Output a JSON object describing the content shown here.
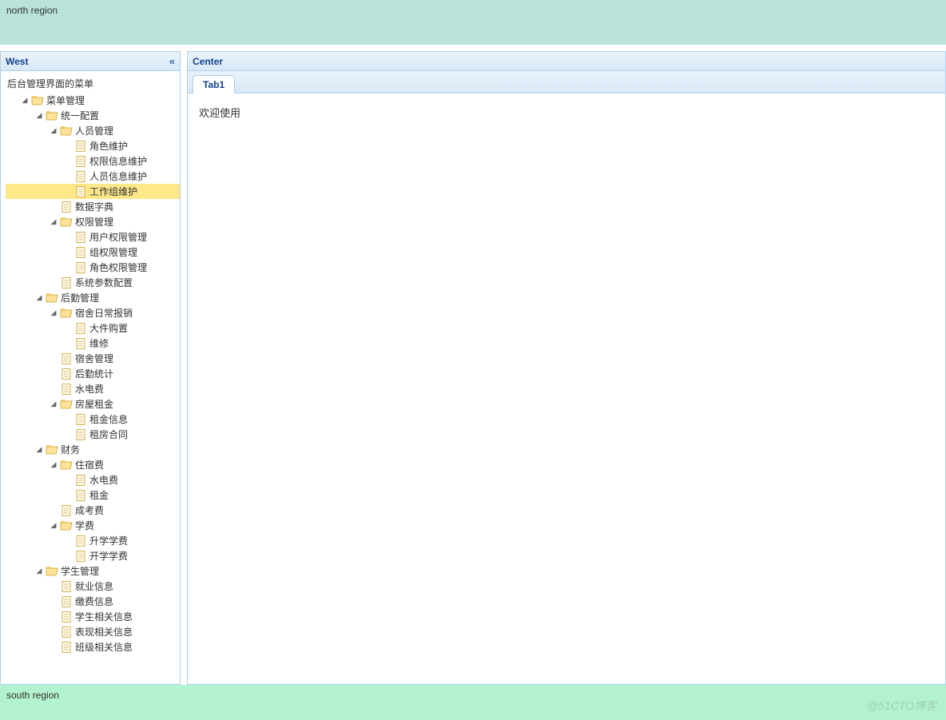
{
  "north": {
    "text": "north region"
  },
  "south": {
    "text": "south region"
  },
  "watermark": "@51CTO博客",
  "west": {
    "title": "West",
    "root_label": "后台管理界面的菜单",
    "selected": "工作组维护",
    "tree": [
      {
        "label": "菜单管理",
        "type": "folder",
        "open": true,
        "children": [
          {
            "label": "统一配置",
            "type": "folder",
            "open": true,
            "children": [
              {
                "label": "人员管理",
                "type": "folder",
                "open": true,
                "children": [
                  {
                    "label": "角色维护",
                    "type": "leaf"
                  },
                  {
                    "label": "权限信息维护",
                    "type": "leaf"
                  },
                  {
                    "label": "人员信息维护",
                    "type": "leaf"
                  },
                  {
                    "label": "工作组维护",
                    "type": "leaf"
                  }
                ]
              },
              {
                "label": "数据字典",
                "type": "leaf"
              },
              {
                "label": "权限管理",
                "type": "folder",
                "open": true,
                "children": [
                  {
                    "label": "用户权限管理",
                    "type": "leaf"
                  },
                  {
                    "label": "组权限管理",
                    "type": "leaf"
                  },
                  {
                    "label": "角色权限管理",
                    "type": "leaf"
                  }
                ]
              },
              {
                "label": "系统参数配置",
                "type": "leaf"
              }
            ]
          },
          {
            "label": "后勤管理",
            "type": "folder",
            "open": true,
            "children": [
              {
                "label": "宿舍日常报销",
                "type": "folder",
                "open": true,
                "children": [
                  {
                    "label": "大件购置",
                    "type": "leaf"
                  },
                  {
                    "label": "维修",
                    "type": "leaf"
                  }
                ]
              },
              {
                "label": "宿舍管理",
                "type": "leaf"
              },
              {
                "label": "后勤统计",
                "type": "leaf"
              },
              {
                "label": "水电费",
                "type": "leaf"
              },
              {
                "label": "房屋租金",
                "type": "folder",
                "open": true,
                "children": [
                  {
                    "label": "租金信息",
                    "type": "leaf"
                  },
                  {
                    "label": "租房合同",
                    "type": "leaf"
                  }
                ]
              }
            ]
          },
          {
            "label": "财务",
            "type": "folder",
            "open": true,
            "children": [
              {
                "label": "住宿费",
                "type": "folder",
                "open": true,
                "children": [
                  {
                    "label": "水电费",
                    "type": "leaf"
                  },
                  {
                    "label": "租金",
                    "type": "leaf"
                  }
                ]
              },
              {
                "label": "成考费",
                "type": "leaf"
              },
              {
                "label": "学费",
                "type": "folder",
                "open": true,
                "children": [
                  {
                    "label": "升学学费",
                    "type": "leaf"
                  },
                  {
                    "label": "开学学费",
                    "type": "leaf"
                  }
                ]
              }
            ]
          },
          {
            "label": "学生管理",
            "type": "folder",
            "open": true,
            "children": [
              {
                "label": "就业信息",
                "type": "leaf"
              },
              {
                "label": "缴费信息",
                "type": "leaf"
              },
              {
                "label": "学生相关信息",
                "type": "leaf"
              },
              {
                "label": "表现相关信息",
                "type": "leaf"
              },
              {
                "label": "班级相关信息",
                "type": "leaf"
              }
            ]
          }
        ]
      }
    ]
  },
  "center": {
    "title": "Center",
    "tabs": [
      {
        "label": "Tab1",
        "content": "欢迎使用"
      }
    ]
  }
}
